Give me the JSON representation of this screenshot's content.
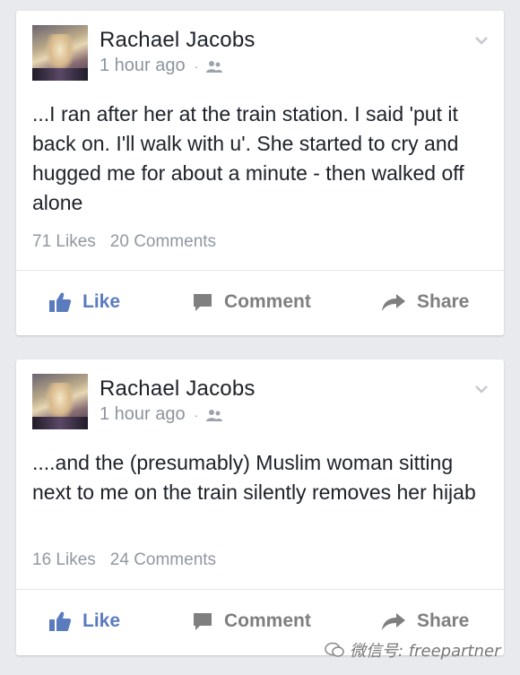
{
  "posts": [
    {
      "author": "Rachael Jacobs",
      "time": "1 hour ago",
      "separator": "·",
      "text": "...I ran after her at the train station. I said 'put it back on. I'll walk with u'. She started to cry and hugged me for about a minute - then walked off alone",
      "likes": "71 Likes",
      "comments": "20 Comments",
      "actions": {
        "like": "Like",
        "comment": "Comment",
        "share": "Share"
      }
    },
    {
      "author": "Rachael Jacobs",
      "time": "1 hour ago",
      "separator": "·",
      "text": "....and the (presumably) Muslim woman sitting next to me on the train silently removes her hijab",
      "likes": "16 Likes",
      "comments": "24 Comments",
      "actions": {
        "like": "Like",
        "comment": "Comment",
        "share": "Share"
      }
    }
  ],
  "watermark": "微信号: freepartner",
  "colors": {
    "background": "#e9eaed",
    "like_blue": "#5b7bbf",
    "action_gray": "#7f7f7f",
    "meta_gray": "#8d949e"
  },
  "icons": [
    "friends-icon",
    "chevron-down-icon",
    "thumbs-up-icon",
    "comment-icon",
    "share-arrow-icon",
    "wechat-icon"
  ]
}
